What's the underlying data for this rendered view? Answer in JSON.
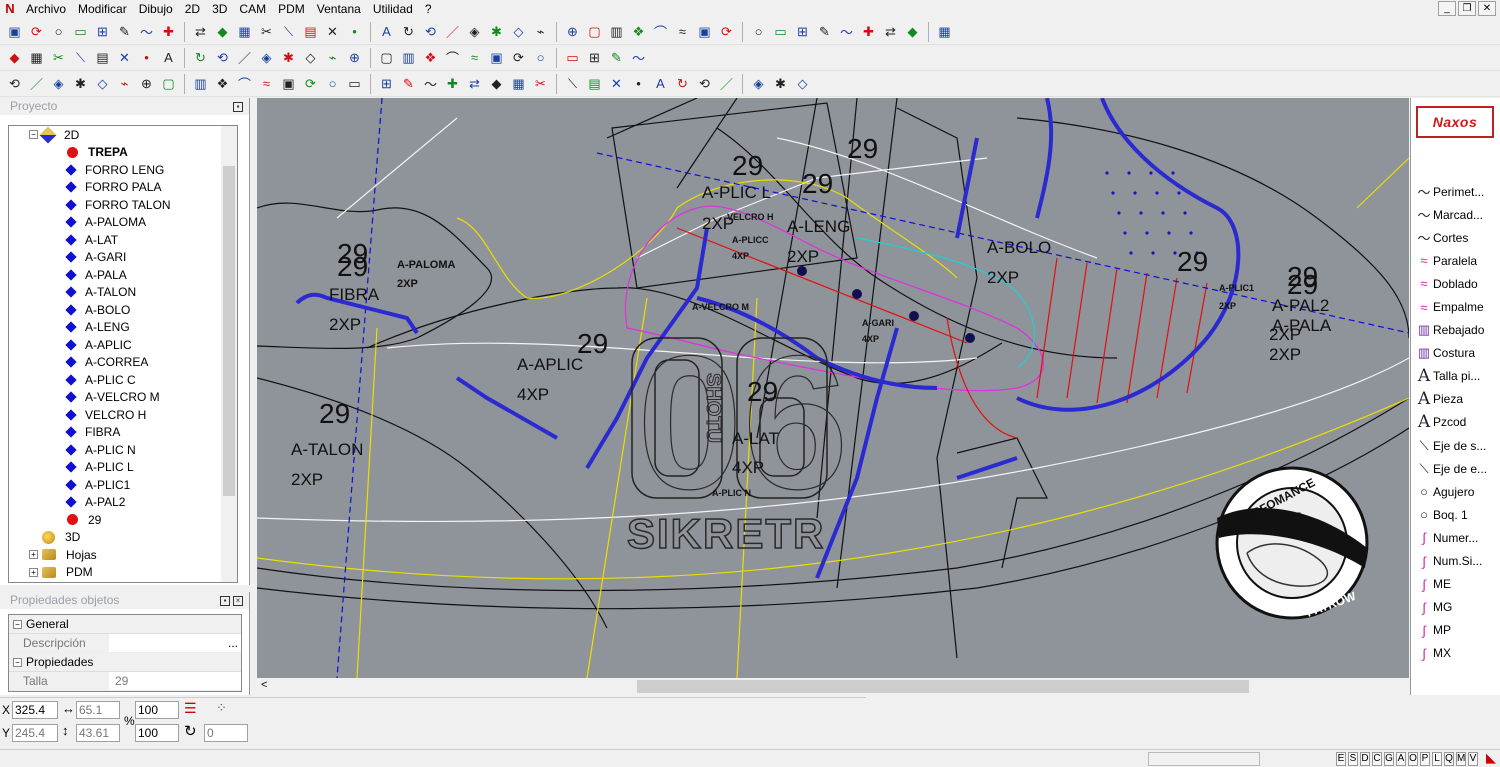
{
  "menu": {
    "items": [
      "Archivo",
      "Modificar",
      "Dibujo",
      "2D",
      "3D",
      "CAM",
      "PDM",
      "Ventana",
      "Utilidad",
      "?"
    ],
    "window_controls": [
      "_",
      "❐",
      "✕"
    ]
  },
  "toolbars": {
    "row1": [
      "new-file-icon",
      "open-folder-icon",
      "save-icon",
      "info-icon",
      "undo-icon",
      "redo-icon",
      "delete-icon",
      "properties-icon",
      "layers-icon",
      "color-icon",
      "insert-icon",
      "cancel-icon",
      "move-icon",
      "stretch-icon",
      "curve-icon",
      "line-icon",
      "circle-icon",
      "point-icon",
      "arc-icon",
      "trim-icon",
      "snap-icon",
      "node-icon",
      "fillet-icon",
      "rect-icon",
      "text-icon",
      "wave-icon",
      "tangent-icon",
      "offset-icon",
      "rectangle-icon",
      "pen-icon",
      "zigzag-icon",
      "mark-icon",
      "corner-icon",
      "bevel-icon",
      "page-icon",
      "cut-icon",
      "move-cross-icon",
      "hash-icon",
      "connect-icon",
      "magic-icon",
      "refresh-icon"
    ],
    "row2": [
      "select-arrow-icon",
      "pattern-icon",
      "shape-icon",
      "zoom-in-icon",
      "zoom-out-icon",
      "zoom-fit-icon",
      "ruler-icon",
      "print-icon",
      "help-icon",
      "align-icon",
      "mirror-icon",
      "layers-icon",
      "grid-icon",
      "table-icon",
      "scale-icon",
      "block-icon",
      "arrow-up-icon",
      "line-tool-icon",
      "circle-tool-icon",
      "dim-icon",
      "hline-icon",
      "vline-icon",
      "cross-icon",
      "distance-icon",
      "measure-h-icon",
      "measure-v-icon",
      "cursor-icon",
      "angle-icon"
    ],
    "row3": [
      "curve-a-icon",
      "curve-b-icon",
      "curve-c-icon",
      "curve-d-icon",
      "curve-e-icon",
      "ellipse-icon",
      "target-icon",
      "rotate-icon",
      "copy-icon",
      "paste-icon",
      "cut-tool-icon",
      "array-icon",
      "flip-icon",
      "divide-icon",
      "extend-icon",
      "join-icon",
      "spline-icon",
      "brush-icon",
      "wave-tool-icon",
      "knife-icon",
      "scissors-icon",
      "rotate-cw-icon",
      "explode-icon",
      "group-icon",
      "ungroup-icon",
      "shrink-icon",
      "mirror-h-icon",
      "mirror-v-icon",
      "search-icon",
      "search-all-icon",
      "eye-icon",
      "select-all-icon",
      "film-icon",
      "render-icon",
      "export-icon"
    ]
  },
  "project_panel": {
    "title": "Proyecto",
    "tree": [
      {
        "label": "2D",
        "level": 1,
        "icon": "d2",
        "expander": "−",
        "bold": false
      },
      {
        "label": "TREPA",
        "level": 2,
        "icon": "dot",
        "bold": true
      },
      {
        "label": "FORRO LENG",
        "level": 2,
        "icon": "diamond"
      },
      {
        "label": "FORRO PALA",
        "level": 2,
        "icon": "diamond"
      },
      {
        "label": "FORRO TALON",
        "level": 2,
        "icon": "diamond"
      },
      {
        "label": "A-PALOMA",
        "level": 2,
        "icon": "diamond"
      },
      {
        "label": "A-LAT",
        "level": 2,
        "icon": "diamond"
      },
      {
        "label": "A-GARI",
        "level": 2,
        "icon": "diamond"
      },
      {
        "label": "A-PALA",
        "level": 2,
        "icon": "diamond"
      },
      {
        "label": "A-TALON",
        "level": 2,
        "icon": "diamond"
      },
      {
        "label": "A-BOLO",
        "level": 2,
        "icon": "diamond"
      },
      {
        "label": "A-LENG",
        "level": 2,
        "icon": "diamond"
      },
      {
        "label": "A-APLIC",
        "level": 2,
        "icon": "diamond"
      },
      {
        "label": "A-CORREA",
        "level": 2,
        "icon": "diamond"
      },
      {
        "label": "A-PLIC C",
        "level": 2,
        "icon": "diamond"
      },
      {
        "label": "A-VELCRO M",
        "level": 2,
        "icon": "diamond"
      },
      {
        "label": "VELCRO H",
        "level": 2,
        "icon": "diamond"
      },
      {
        "label": "FIBRA",
        "level": 2,
        "icon": "diamond"
      },
      {
        "label": "A-PLIC N",
        "level": 2,
        "icon": "diamond"
      },
      {
        "label": "A-PLIC L",
        "level": 2,
        "icon": "diamond"
      },
      {
        "label": "A-PLIC1",
        "level": 2,
        "icon": "diamond"
      },
      {
        "label": "A-PAL2",
        "level": 2,
        "icon": "diamond"
      },
      {
        "label": "29",
        "level": 2,
        "icon": "dot"
      },
      {
        "label": "3D",
        "level": 1,
        "icon": "d3",
        "expander": ""
      },
      {
        "label": "Hojas",
        "level": 1,
        "icon": "folder",
        "expander": "+"
      },
      {
        "label": "PDM",
        "level": 1,
        "icon": "folder",
        "expander": "+"
      }
    ]
  },
  "properties_panel": {
    "title": "Propiedades objetos",
    "general_label": "General",
    "description_label": "Descripción",
    "properties_label": "Propiedades",
    "talla_label": "Talla",
    "talla_value": "29",
    "ellipsis": "..."
  },
  "coords": {
    "x_label": "X",
    "y_label": "Y",
    "x_value": "325.4",
    "y_value": "245.4",
    "dx_value": "65.1",
    "dy_value": "43.61",
    "pct_label": "%",
    "scale_x": "100",
    "scale_y": "100",
    "angle_value": "0"
  },
  "status": {
    "letters": [
      "E",
      "S",
      "D",
      "C",
      "G",
      "A",
      "O",
      "P",
      "L",
      "Q",
      "M",
      "V"
    ]
  },
  "canvas": {
    "labels": [
      {
        "text": "29",
        "cls": "big"
      },
      {
        "text": "29",
        "cls": "big"
      },
      {
        "text": "29",
        "cls": "big"
      },
      {
        "text": "29",
        "cls": "big"
      },
      {
        "text": "29",
        "cls": "big"
      },
      {
        "text": "29",
        "cls": "big"
      },
      {
        "text": "29",
        "cls": "big"
      },
      {
        "text": "29",
        "cls": "big"
      },
      {
        "text": "29",
        "cls": "big"
      },
      {
        "text": "29",
        "cls": "big"
      },
      {
        "text": "29",
        "cls": "big"
      },
      {
        "text": "A-PALOMA",
        "cls": "sm"
      },
      {
        "text": "2XP",
        "cls": "sm"
      },
      {
        "text": "FIBRA",
        "cls": "md"
      },
      {
        "text": "2XP",
        "cls": "md"
      },
      {
        "text": "A-PLIC L",
        "cls": "md"
      },
      {
        "text": "2XP",
        "cls": "md"
      },
      {
        "text": "A-LENG",
        "cls": "md"
      },
      {
        "text": "2XP",
        "cls": "md"
      },
      {
        "text": "A-BOLO",
        "cls": "md"
      },
      {
        "text": "2XP",
        "cls": "md"
      },
      {
        "text": "A-PAL2",
        "cls": "md"
      },
      {
        "text": "A-PALA",
        "cls": "md"
      },
      {
        "text": "2XP",
        "cls": "md"
      },
      {
        "text": "2XP",
        "cls": "md"
      },
      {
        "text": "A-APLIC",
        "cls": "md"
      },
      {
        "text": "4XP",
        "cls": "md"
      },
      {
        "text": "A-TALON",
        "cls": "md"
      },
      {
        "text": "2XP",
        "cls": "md"
      },
      {
        "text": "A-LAT",
        "cls": "md"
      },
      {
        "text": "4XP",
        "cls": "md"
      },
      {
        "text": "A-GARI",
        "cls": "xs"
      },
      {
        "text": "4XP",
        "cls": "xs"
      },
      {
        "text": "A-PLICC",
        "cls": "xs"
      },
      {
        "text": "4XP",
        "cls": "xs"
      },
      {
        "text": "VELCRO H",
        "cls": "xs"
      },
      {
        "text": "A-PLIC1",
        "cls": "xs"
      },
      {
        "text": "2XP",
        "cls": "xs"
      },
      {
        "text": "A-VELCRO M",
        "cls": "xs"
      },
      {
        "text": "A-PLIC N",
        "cls": "xs"
      }
    ],
    "logo_digits": "06",
    "logo_vertical": "SHOTU",
    "logo_word": "SIKRETR",
    "watermark_top": "PERFOMANCE",
    "watermark_mid": "PDF",
    "watermark_bottom": "PATROW"
  },
  "right_panel": {
    "logo": "Naxos",
    "tools": [
      {
        "label": "Perimet...",
        "icon": "〜",
        "cls": ""
      },
      {
        "label": "Marcad...",
        "icon": "〜",
        "cls": ""
      },
      {
        "label": "Cortes",
        "icon": "〜",
        "cls": ""
      },
      {
        "label": "Paralela",
        "icon": "≈",
        "cls": "pink"
      },
      {
        "label": "Doblado",
        "icon": "≈",
        "cls": "pink"
      },
      {
        "label": "Empalme",
        "icon": "≈",
        "cls": "pink"
      },
      {
        "label": "Rebajado",
        "icon": "▥",
        "cls": "purple"
      },
      {
        "label": "Costura",
        "icon": "▥",
        "cls": "purple"
      },
      {
        "label": "Talla pi...",
        "icon": "A",
        "cls": "big"
      },
      {
        "label": "Pieza",
        "icon": "A",
        "cls": "big"
      },
      {
        "label": "Pzcod",
        "icon": "A",
        "cls": "big"
      },
      {
        "label": "Eje de s...",
        "icon": "⟍",
        "cls": ""
      },
      {
        "label": "Eje de e...",
        "icon": "⟍",
        "cls": ""
      },
      {
        "label": "Agujero",
        "icon": "○",
        "cls": ""
      },
      {
        "label": "Boq. 1",
        "icon": "○",
        "cls": ""
      },
      {
        "label": "Numer...",
        "icon": "∫",
        "cls": "pink"
      },
      {
        "label": "Num.Si...",
        "icon": "∫",
        "cls": "pink"
      },
      {
        "label": "ME",
        "icon": "∫",
        "cls": "pink"
      },
      {
        "label": "MG",
        "icon": "∫",
        "cls": "pink"
      },
      {
        "label": "MP",
        "icon": "∫",
        "cls": "pink"
      },
      {
        "label": "MX",
        "icon": "∫",
        "cls": "pink"
      }
    ]
  }
}
